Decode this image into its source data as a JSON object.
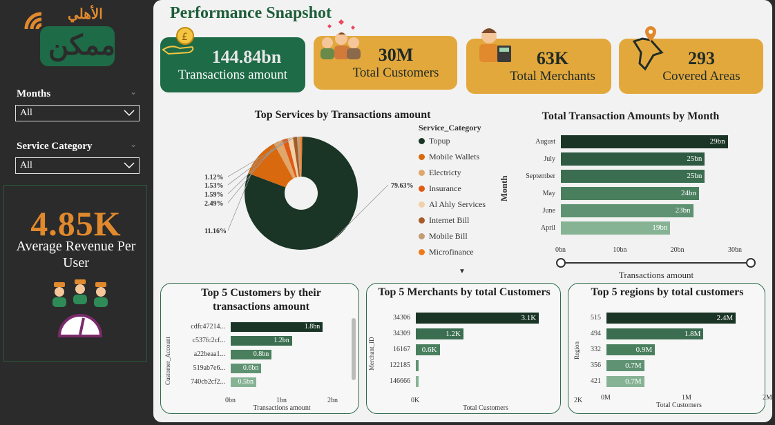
{
  "logo": {
    "arabic": "الأهلي",
    "brand": "ممكن"
  },
  "filters": [
    {
      "title": "Months",
      "value": "All"
    },
    {
      "title": "Service Category",
      "value": "All"
    }
  ],
  "avg_revenue": {
    "value": "4.85K",
    "label": "Average Revenue Per User"
  },
  "page_title": "Performance Snapshot",
  "kpis": [
    {
      "value": "144.84bn",
      "label": "Transactions amount",
      "icon": "coin-hand-icon"
    },
    {
      "value": "30M",
      "label": "Total Customers",
      "icon": "people-icon"
    },
    {
      "value": "63K",
      "label": "Total Merchants",
      "icon": "merchant-icon"
    },
    {
      "value": "293",
      "label": "Covered Areas",
      "icon": "map-pin-icon"
    }
  ],
  "colors": {
    "accent_green": "#1e6b47",
    "gold": "#e3a83c",
    "orange": "#e0892d"
  },
  "chart_data": [
    {
      "type": "pie",
      "title": "Top Services by Transactions amount",
      "legend_title": "Service_Category",
      "categories": [
        "Topup",
        "Mobile Wallets",
        "Electricty",
        "Insurance",
        "Al Ahly Services",
        "Internet Bill",
        "Mobile Bill",
        "Microfinance"
      ],
      "values": [
        79.63,
        11.16,
        2.49,
        1.59,
        1.53,
        1.12,
        1.0,
        0.5
      ],
      "data_labels": [
        "79.63%",
        "11.16%",
        "2.49%",
        "1.59%",
        "1.53%",
        "1.12%"
      ],
      "colors": [
        "#1a3526",
        "#d9690e",
        "#e0a66b",
        "#e15b14",
        "#f1d1a9",
        "#a55c28",
        "#c49c74",
        "#f07a1b"
      ]
    },
    {
      "type": "bar",
      "title": "Total Transaction Amounts by Month",
      "xlabel": "Transactions amount",
      "ylabel": "Month",
      "categories": [
        "August",
        "July",
        "September",
        "May",
        "June",
        "April"
      ],
      "values": [
        29,
        25,
        25,
        24,
        23,
        19
      ],
      "data_labels": [
        "29bn",
        "25bn",
        "25bn",
        "24bn",
        "23bn",
        "19bn"
      ],
      "xticks": [
        "0bn",
        "10bn",
        "20bn",
        "30bn"
      ],
      "xlim": [
        0,
        30
      ]
    },
    {
      "type": "bar",
      "title": "Top 5 Customers by their transactions amount",
      "xlabel": "Transactions amount",
      "ylabel": "Customer_Account",
      "categories": [
        "cdfc47214...",
        "c537fc2cf...",
        "a22beaa1...",
        "519ab7e6...",
        "740cb2cf2..."
      ],
      "values": [
        1.8,
        1.2,
        0.8,
        0.6,
        0.5
      ],
      "data_labels": [
        "1.8bn",
        "1.2bn",
        "0.8bn",
        "0.6bn",
        "0.5bn"
      ],
      "xticks": [
        "0bn",
        "1bn",
        "2bn"
      ],
      "xlim": [
        0,
        2
      ]
    },
    {
      "type": "bar",
      "title": "Top 5 Merchants by total Customers",
      "xlabel": "Total Customers",
      "ylabel": "Merchant_ID",
      "categories": [
        "34306",
        "34309",
        "16167",
        "122185",
        "146666"
      ],
      "values": [
        3.1,
        1.2,
        0.6,
        0.05,
        0.03
      ],
      "data_labels": [
        "3.1K",
        "1.2K",
        "0.6K",
        "",
        ""
      ],
      "xticks": [
        "0K",
        "2K"
      ],
      "xlim": [
        0,
        4
      ]
    },
    {
      "type": "bar",
      "title": "Top 5 regions by total customers",
      "xlabel": "Total Customers",
      "ylabel": "Region",
      "categories": [
        "515",
        "494",
        "332",
        "356",
        "421"
      ],
      "values": [
        2.4,
        1.8,
        0.9,
        0.7,
        0.7
      ],
      "data_labels": [
        "2.4M",
        "1.8M",
        "0.9M",
        "0.7M",
        "0.7M"
      ],
      "xticks": [
        "0M",
        "1M",
        "2M"
      ],
      "xlim": [
        0,
        3
      ]
    }
  ]
}
